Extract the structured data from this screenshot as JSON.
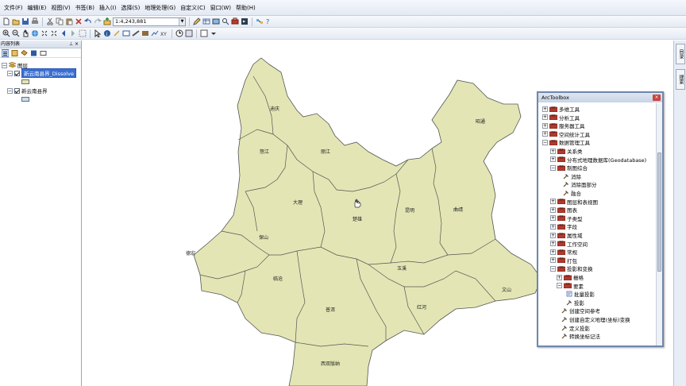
{
  "menubar": {
    "items": [
      "文件(F)",
      "编辑(E)",
      "视图(V)",
      "书签(B)",
      "插入(I)",
      "选择(S)",
      "地理处理(G)",
      "自定义(C)",
      "窗口(W)",
      "帮助(H)"
    ]
  },
  "toolbar": {
    "scale_value": "1:4,243,881"
  },
  "toc": {
    "title": "内容列表",
    "root_label": "图层",
    "layers": [
      {
        "label": "新云南县界_Dissolve",
        "checked": true,
        "selected": true,
        "swatch_color": "#e3e6b4"
      },
      {
        "label": "新云南县界",
        "checked": true,
        "selected": false,
        "swatch_color": "#c8def0"
      }
    ]
  },
  "map": {
    "fill_color": "#e3e6b4",
    "stroke_color": "#555555",
    "labels": [
      "迪庆",
      "怒江",
      "丽江",
      "大理",
      "楚雄",
      "昆明",
      "曲靖",
      "昭通",
      "保山",
      "德宏",
      "临沧",
      "普洱",
      "玉溪",
      "红河",
      "文山",
      "西双版纳"
    ]
  },
  "right_dock": {
    "tabs": [
      "目录",
      "搜索"
    ]
  },
  "arctoolbox": {
    "title": "ArcToolbox",
    "close_label": "×",
    "items": [
      {
        "label": "多维工具",
        "type": "toolbox",
        "expander": "+"
      },
      {
        "label": "分析工具",
        "type": "toolbox",
        "expander": "+"
      },
      {
        "label": "服务器工具",
        "type": "toolbox",
        "expander": "+"
      },
      {
        "label": "空间统计工具",
        "type": "toolbox",
        "expander": "+"
      },
      {
        "label": "数据管理工具",
        "type": "toolbox",
        "expander": "−"
      },
      {
        "label": "关系类",
        "type": "toolset",
        "expander": "+"
      },
      {
        "label": "分布式地理数据库(Geodatabase)",
        "type": "toolset",
        "expander": "+"
      },
      {
        "label": "制图综合",
        "type": "toolset",
        "expander": "−"
      },
      {
        "label": "消除",
        "type": "tool",
        "expander": ""
      },
      {
        "label": "消除面部分",
        "type": "tool",
        "expander": ""
      },
      {
        "label": "融合",
        "type": "tool",
        "expander": ""
      },
      {
        "label": "图层和表视图",
        "type": "toolset",
        "expander": "+"
      },
      {
        "label": "图表",
        "type": "toolset",
        "expander": "+"
      },
      {
        "label": "子类型",
        "type": "toolset",
        "expander": "+"
      },
      {
        "label": "字段",
        "type": "toolset",
        "expander": "+"
      },
      {
        "label": "属性域",
        "type": "toolset",
        "expander": "+"
      },
      {
        "label": "工作空间",
        "type": "toolset",
        "expander": "+"
      },
      {
        "label": "常规",
        "type": "toolset",
        "expander": "+"
      },
      {
        "label": "打包",
        "type": "toolset",
        "expander": "+"
      },
      {
        "label": "投影和变换",
        "type": "toolset",
        "expander": "−"
      },
      {
        "label": "栅格",
        "type": "toolset",
        "expander": "+"
      },
      {
        "label": "要素",
        "type": "toolset",
        "expander": "−"
      },
      {
        "label": "批量投影",
        "type": "script",
        "expander": ""
      },
      {
        "label": "投影",
        "type": "tool",
        "expander": ""
      },
      {
        "label": "创建空间参考",
        "type": "tool",
        "expander": ""
      },
      {
        "label": "创建自定义地理(坐标)变换",
        "type": "tool",
        "expander": ""
      },
      {
        "label": "定义投影",
        "type": "tool",
        "expander": ""
      },
      {
        "label": "转换坐标记法",
        "type": "tool",
        "expander": ""
      }
    ]
  },
  "icons": [
    "new-document-icon",
    "open-icon",
    "save-icon",
    "print-icon",
    "cut-icon",
    "copy-icon",
    "paste-icon",
    "delete-icon",
    "undo-icon",
    "redo-icon",
    "add-data-icon",
    "editor-icon",
    "catalog-icon",
    "search-icon",
    "arctoolbox-icon",
    "python-icon",
    "zoom-in-icon",
    "zoom-out-icon",
    "pan-icon",
    "full-extent-icon",
    "identify-icon",
    "find-icon",
    "measure-icon",
    "hyperlink-icon",
    "select-icon",
    "what-is-this-icon"
  ]
}
